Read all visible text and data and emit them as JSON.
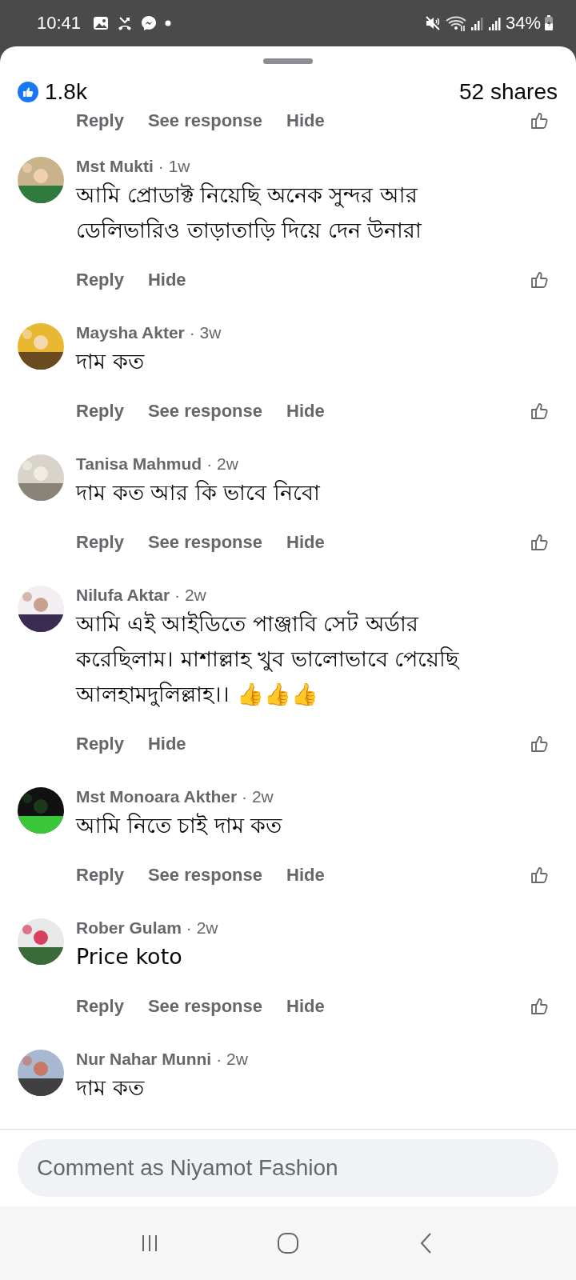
{
  "status_bar": {
    "time": "10:41",
    "battery": "34%"
  },
  "reactions": {
    "count": "1.8k",
    "shares": "52 shares"
  },
  "cut_actions": [
    "Reply",
    "See response",
    "Hide"
  ],
  "comments": [
    {
      "author": "Mst Mukti",
      "age": "· 1w",
      "text": "আমি প্রোডাক্ট নিয়েছি অনেক সুন্দর আর ডেলিভারিও তাড়াতাড়ি দিয়ে দেন উনারা",
      "actions": [
        "Reply",
        "Hide"
      ]
    },
    {
      "author": "Maysha Akter",
      "age": "· 3w",
      "text": "দাম কত",
      "actions": [
        "Reply",
        "See response",
        "Hide"
      ]
    },
    {
      "author": "Tanisa Mahmud",
      "age": "· 2w",
      "text": "দাম কত আর কি ভাবে নিবো",
      "actions": [
        "Reply",
        "See response",
        "Hide"
      ]
    },
    {
      "author": "Nilufa Aktar",
      "age": "· 2w",
      "text": "আমি এই আইডিতে পাঞ্জাবি সেট অর্ডার করেছিলাম। মাশাল্লাহ খুব ভালোভাবে পেয়েছি আলহামদুলিল্লাহ।। 👍👍👍",
      "actions": [
        "Reply",
        "Hide"
      ]
    },
    {
      "author": "Mst Monoara Akther",
      "age": "· 2w",
      "text": "আমি নিতে চাই দাম কত",
      "actions": [
        "Reply",
        "See response",
        "Hide"
      ]
    },
    {
      "author": "Rober Gulam",
      "age": "· 2w",
      "text": "Price koto",
      "actions": [
        "Reply",
        "See response",
        "Hide"
      ]
    },
    {
      "author": "Nur Nahar Munni",
      "age": "· 2w",
      "text": "দাম কত"
    }
  ],
  "comment_field": {
    "placeholder": "Comment as Niyamot Fashion"
  }
}
